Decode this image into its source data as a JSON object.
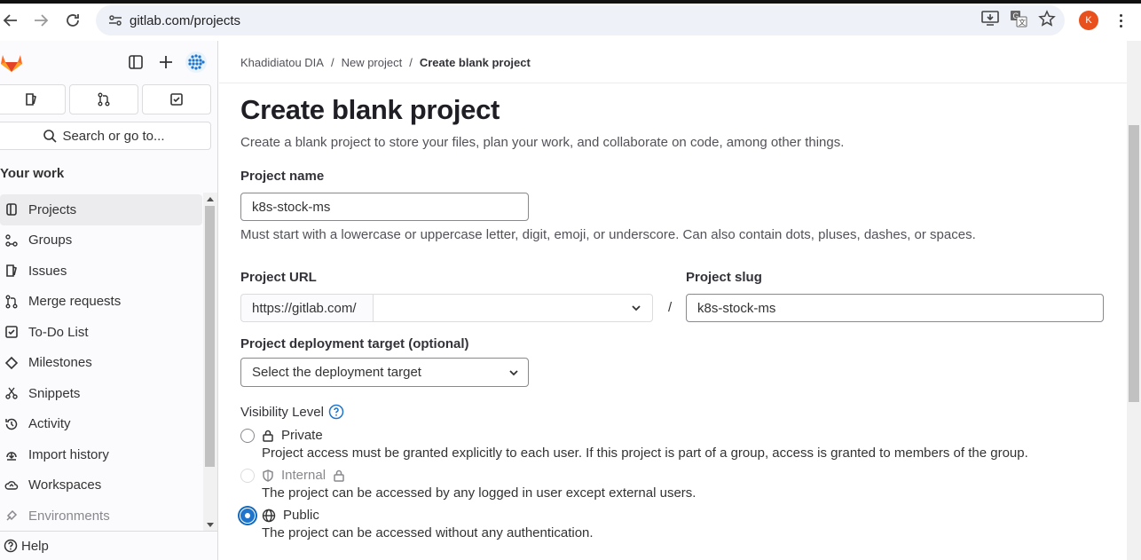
{
  "browser": {
    "url": "gitlab.com/projects",
    "avatar_letter": "K"
  },
  "sidebar": {
    "search_label": "Search or go to...",
    "section_title": "Your work",
    "items": [
      {
        "label": "Projects",
        "icon": "project-icon",
        "active": true
      },
      {
        "label": "Groups",
        "icon": "group-icon"
      },
      {
        "label": "Issues",
        "icon": "issues-icon"
      },
      {
        "label": "Merge requests",
        "icon": "merge-request-icon"
      },
      {
        "label": "To-Do List",
        "icon": "todo-icon"
      },
      {
        "label": "Milestones",
        "icon": "milestone-icon"
      },
      {
        "label": "Snippets",
        "icon": "snippet-icon"
      },
      {
        "label": "Activity",
        "icon": "history-icon"
      },
      {
        "label": "Import history",
        "icon": "import-icon"
      },
      {
        "label": "Workspaces",
        "icon": "workspace-icon"
      },
      {
        "label": "Environments",
        "icon": "environment-icon"
      }
    ],
    "help_label": "Help"
  },
  "breadcrumb": {
    "items": [
      "Khadidiatou DIA",
      "New project",
      "Create blank project"
    ]
  },
  "page": {
    "title": "Create blank project",
    "description": "Create a blank project to store your files, plan your work, and collaborate on code, among other things."
  },
  "form": {
    "project_name_label": "Project name",
    "project_name_value": "k8s-stock-ms",
    "project_name_help": "Must start with a lowercase or uppercase letter, digit, emoji, or underscore. Can also contain dots, pluses, dashes, or spaces.",
    "project_url_label": "Project URL",
    "project_url_prefix": "https://gitlab.com/",
    "namespace_value": "",
    "slash": "/",
    "project_slug_label": "Project slug",
    "project_slug_value": "k8s-stock-ms",
    "deployment_label": "Project deployment target (optional)",
    "deployment_placeholder": "Select the deployment target",
    "visibility_label": "Visibility Level",
    "visibility_options": [
      {
        "label": "Private",
        "description": "Project access must be granted explicitly to each user. If this project is part of a group, access is granted to members of the group.",
        "state": "unchecked"
      },
      {
        "label": "Internal",
        "description": "The project can be accessed by any logged in user except external users.",
        "state": "disabled"
      },
      {
        "label": "Public",
        "description": "The project can be accessed without any authentication.",
        "state": "checked"
      }
    ]
  },
  "colors": {
    "accent": "#1f75cb",
    "brand_orange": "#fc6d26",
    "avatar": "#e8501d"
  }
}
